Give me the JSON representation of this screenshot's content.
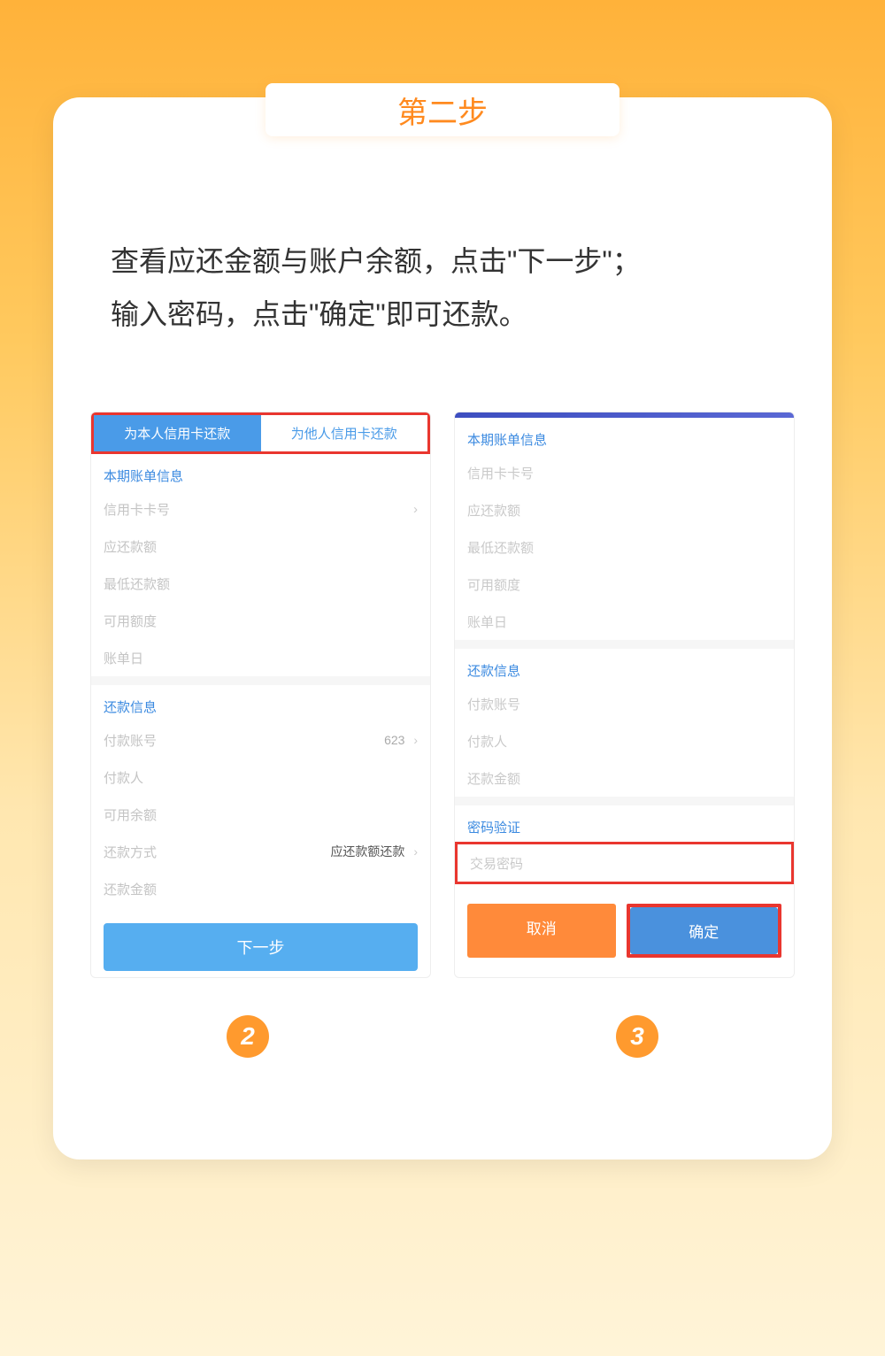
{
  "step_title": "第二步",
  "instruction_line1": "查看应还金额与账户余额，点击\"下一步\"；",
  "instruction_line2": "输入密码，点击\"确定\"即可还款。",
  "screen2": {
    "tab_active": "为本人信用卡还款",
    "tab_inactive": "为他人信用卡还款",
    "section_bill": "本期账单信息",
    "row_card": "信用卡卡号",
    "row_due": "应还款额",
    "row_min": "最低还款额",
    "row_avail": "可用额度",
    "row_date": "账单日",
    "section_repay": "还款信息",
    "row_payacct": "付款账号",
    "val_payacct": "623",
    "row_payer": "付款人",
    "row_usable": "可用余额",
    "row_method": "还款方式",
    "val_method": "应还款额还款",
    "row_amount": "还款金额",
    "btn_next": "下一步"
  },
  "screen3": {
    "section_bill": "本期账单信息",
    "row_card": "信用卡卡号",
    "row_due": "应还款额",
    "row_min": "最低还款额",
    "row_avail": "可用额度",
    "row_date": "账单日",
    "section_repay": "还款信息",
    "row_payacct": "付款账号",
    "row_payer": "付款人",
    "row_amount": "还款金额",
    "section_pw": "密码验证",
    "row_pw": "交易密码",
    "btn_cancel": "取消",
    "btn_confirm": "确定"
  },
  "badges": {
    "b2": "2",
    "b3": "3"
  }
}
